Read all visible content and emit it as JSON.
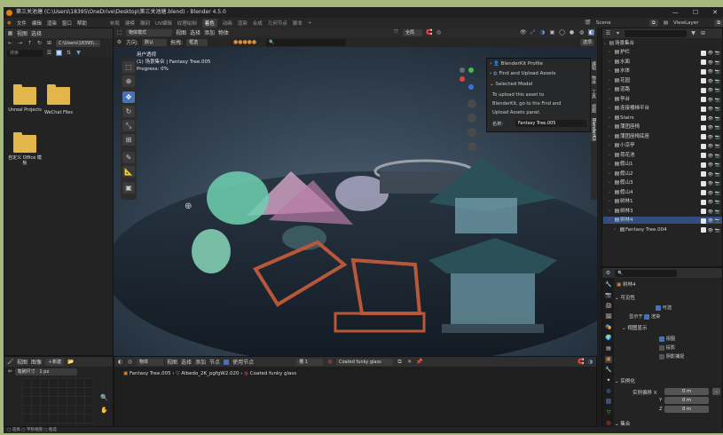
{
  "window": {
    "title": "第三关池塘 (C:\\Users\\18395\\OneDrive\\Desktop\\第三关池塘.blend) - Blender 4.5.0"
  },
  "menu": {
    "items": [
      "文件",
      "编辑",
      "渲染",
      "窗口",
      "帮助"
    ],
    "workspaces": [
      "布局",
      "建模",
      "雕刻",
      "UV编辑",
      "纹理绘制",
      "着色",
      "动画",
      "渲染",
      "合成",
      "几何节点",
      "脚本"
    ],
    "active_workspace": "着色",
    "scene": "Scene",
    "view_layer": "ViewLayer"
  },
  "file_browser": {
    "header": [
      "视图",
      "选择"
    ],
    "path": "C:\\Users\\18395\\...",
    "search_placeholder": "搜索",
    "folders": [
      "Unreal Projects",
      "WeChat Files",
      "自定义 Office 模板"
    ]
  },
  "viewport": {
    "mode": "物体模式",
    "menus": [
      "视图",
      "选择",
      "添加",
      "物体"
    ],
    "orientation_label": "方向:",
    "orientation_value": "默认",
    "drag_label": "拖拽:",
    "drag_value": "框选",
    "pivot": "全局",
    "overlay_lines": [
      "用户透视",
      "(1) 场景集合 | Fantasy Tree.005",
      "Progress: 0%"
    ],
    "options_label": "选项"
  },
  "blenderkit": {
    "items": [
      "BlenderKit Profile",
      "Find and Upload Assets",
      "Selected Model"
    ],
    "text": [
      "To upload this asset to",
      "BlenderKit, go to the Find and",
      "Upload Assets panel."
    ],
    "name_label": "名称:",
    "name_value": "Fantasy Tree.005"
  },
  "side_tabs": [
    "编辑",
    "物体",
    "工具",
    "视图",
    "BlenderKit"
  ],
  "outliner": {
    "search_placeholder": "",
    "root": "场景集合",
    "rows": [
      {
        "label": "护栏",
        "selected": false
      },
      {
        "label": "水面",
        "selected": false
      },
      {
        "label": "水体",
        "selected": false
      },
      {
        "label": "花园",
        "selected": false
      },
      {
        "label": "道路",
        "selected": false
      },
      {
        "label": "亭台",
        "selected": false
      },
      {
        "label": "连接楼梯平台",
        "selected": false
      },
      {
        "label": "Stairs",
        "selected": false
      },
      {
        "label": "蒲团座椅",
        "selected": false
      },
      {
        "label": "蒲团座椅底座",
        "selected": false
      },
      {
        "label": "小凉亭",
        "selected": false
      },
      {
        "label": "荷花池",
        "selected": false
      },
      {
        "label": "假山1",
        "selected": false
      },
      {
        "label": "假山2",
        "selected": false
      },
      {
        "label": "假山3",
        "selected": false
      },
      {
        "label": "假山4",
        "selected": false
      },
      {
        "label": "树林1",
        "selected": false
      },
      {
        "label": "树林3",
        "selected": false
      },
      {
        "label": "树林4",
        "selected": true
      },
      {
        "label": "Fantasy Tree.004",
        "selected": false
      }
    ]
  },
  "properties": {
    "object_name": "树林4",
    "sections": {
      "visibility": "可见性",
      "viewport_display": "视图显示",
      "instancing": "实例化",
      "collections": "集合"
    },
    "visibility_rows": [
      {
        "label": "可选",
        "checked": true
      },
      {
        "label": "显示于",
        "value": "渲染",
        "checked": true
      }
    ],
    "viewport_rows": [
      {
        "label": "视图",
        "checked": true
      },
      {
        "label": "投影",
        "checked": false
      },
      {
        "label": "阴影捕捉",
        "checked": false
      }
    ],
    "instancing": {
      "label": "实例偏移 X",
      "x": "0 m",
      "y_label": "Y",
      "y": "0 m",
      "z_label": "Z",
      "z": "0 m"
    }
  },
  "bottom_left": {
    "menus": [
      "视图",
      "图像"
    ],
    "new_label": "新建",
    "brush_label": "笔刷尺寸",
    "brush_value": "1 px"
  },
  "node_editor": {
    "menus": [
      "物体",
      "视图",
      "选择",
      "添加",
      "节点"
    ],
    "use_nodes": "使用节点",
    "slot": "槽 1",
    "material": "Coated funky glass",
    "breadcrumb": [
      "Fantasy Tree.005",
      "Albedo_2K_pgfgW2.020",
      "Coated funky glass"
    ]
  },
  "statusbar": [
    "选择",
    "平移视图",
    "框选"
  ]
}
